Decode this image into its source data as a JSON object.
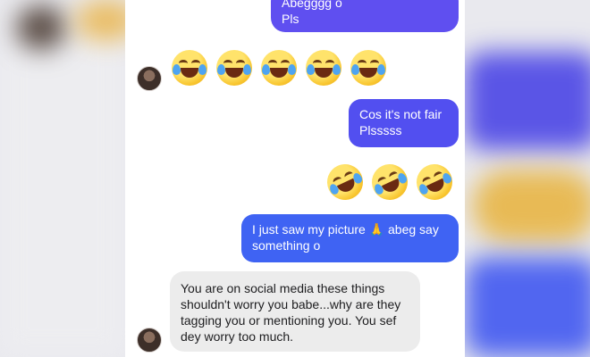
{
  "messages": [
    {
      "direction": "outgoing",
      "text": "Abegggg o\nPls"
    },
    {
      "direction": "incoming",
      "emoji": "😂",
      "count": 5
    },
    {
      "direction": "outgoing",
      "text": "Cos it's not fair\nPlsssss"
    },
    {
      "direction": "outgoing",
      "emoji": "🤣",
      "count": 3
    },
    {
      "direction": "outgoing",
      "text": "I just saw my picture 🙏 abeg say\nsomething o"
    },
    {
      "direction": "incoming",
      "text": "You are on social media these things\nshouldn't worry you babe...why are they\ntagging you or mentioning you. You sef\ndey worry too much."
    }
  ],
  "colors": {
    "outgoing_bubble_1": "#5f4ff0",
    "outgoing_bubble_2": "#524ff0",
    "outgoing_bubble_3": "#3f63f3",
    "incoming_bubble": "#ececec",
    "incoming_text": "#1d1d1f"
  },
  "icons": {
    "tears_of_joy": "face-with-tears-of-joy-icon",
    "rofl": "rolling-on-floor-laughing-icon",
    "avatar": "contact-avatar"
  }
}
